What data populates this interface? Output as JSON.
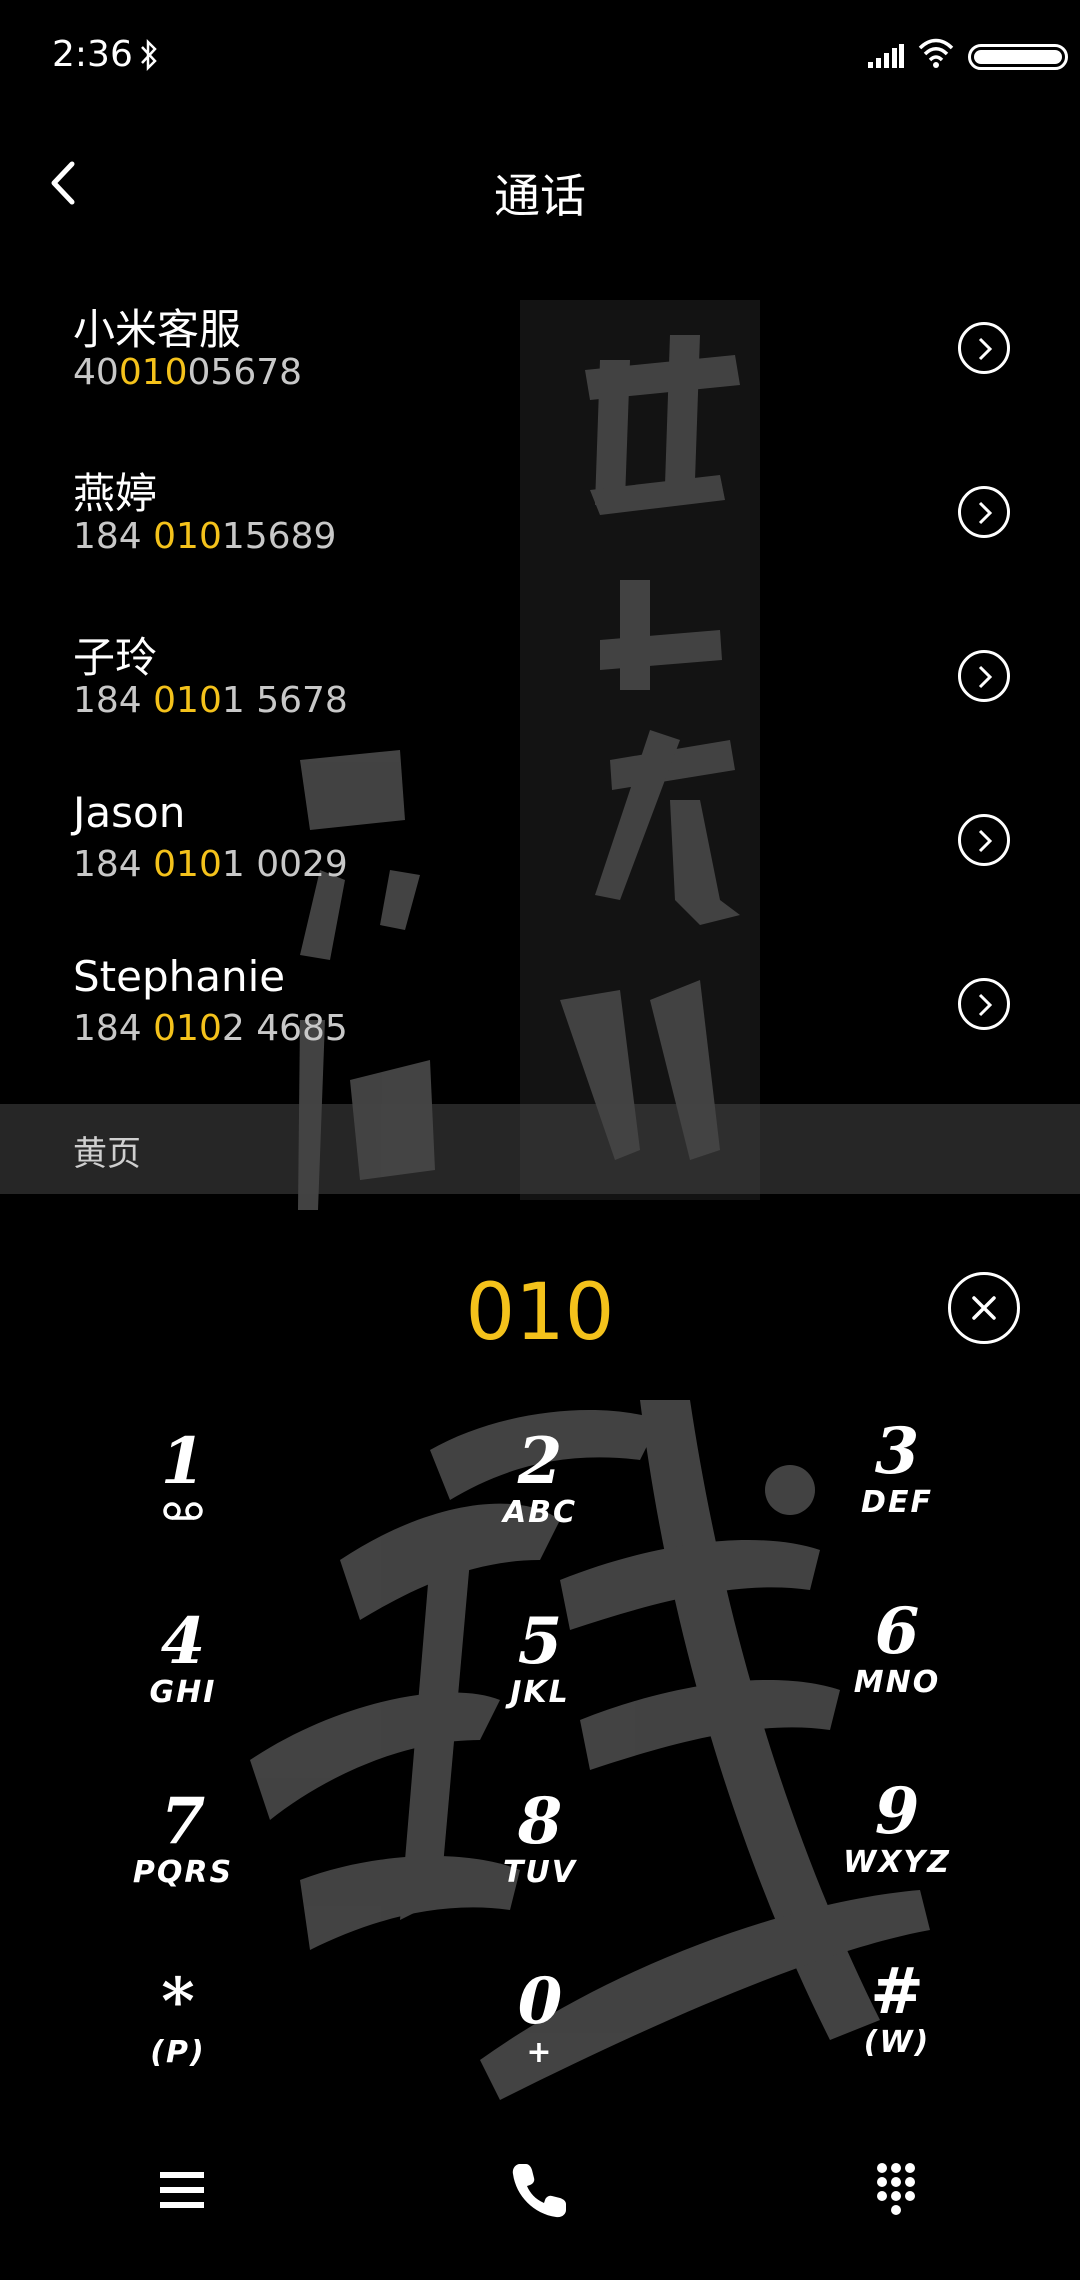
{
  "status_bar": {
    "time": "2:36"
  },
  "header": {
    "title": "通话"
  },
  "contacts": [
    {
      "name": "小米客服",
      "number_pre": "40",
      "number_hl": "010",
      "number_post": "05678"
    },
    {
      "name": "燕婷",
      "number_pre": "184 ",
      "number_hl": "010",
      "number_post": "15689"
    },
    {
      "name": "子玲",
      "number_pre": "184 ",
      "number_hl": "010",
      "number_post": "1 5678"
    },
    {
      "name": "Jason",
      "number_pre": "184 ",
      "number_hl": "010",
      "number_post": "1 0029"
    },
    {
      "name": "Stephanie",
      "number_pre": "184 ",
      "number_hl": "010",
      "number_post": "2 4685"
    }
  ],
  "section": {
    "yellow_pages": "黄页"
  },
  "dialpad": {
    "input": "010",
    "keys": [
      {
        "digit": "1",
        "letters": "ത"
      },
      {
        "digit": "2",
        "letters": "ABC"
      },
      {
        "digit": "3",
        "letters": "DEF"
      },
      {
        "digit": "4",
        "letters": "GHI"
      },
      {
        "digit": "5",
        "letters": "JKL"
      },
      {
        "digit": "6",
        "letters": "MNO"
      },
      {
        "digit": "7",
        "letters": "PQRS"
      },
      {
        "digit": "8",
        "letters": "TUV"
      },
      {
        "digit": "9",
        "letters": "WXYZ"
      },
      {
        "digit": "*",
        "letters": "(P)"
      },
      {
        "digit": "0",
        "letters": "+"
      },
      {
        "digit": "#",
        "letters": "(W)"
      }
    ]
  },
  "colors": {
    "accent": "#f4c21b",
    "background": "#000000"
  }
}
